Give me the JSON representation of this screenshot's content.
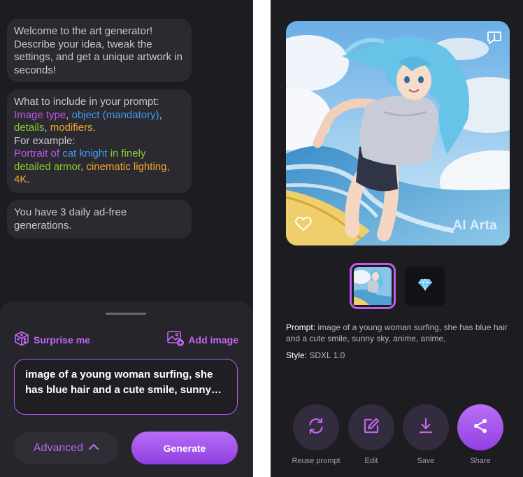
{
  "chat": {
    "welcome": "Welcome to the art generator! Describe your idea, tweak the settings, and get a unique artwork in seconds!",
    "tips": {
      "intro": "What to include in your prompt:",
      "part_image_type": "Image type",
      "sep1": ", ",
      "part_object": "object (mandatory)",
      "sep2": ",",
      "part_details": "details",
      "sep3": ", ",
      "part_modifiers": "modifiers",
      "end": ".",
      "example_label": "For example:",
      "ex_portrait": "Portrait of",
      "ex_cat_knight": "cat knight",
      "ex_finely": "in finely detailed armor",
      "ex_comma": ", ",
      "ex_lighting": "cinematic lighting",
      "ex_comma2": ",",
      "ex_4k": "4K",
      "ex_end": "."
    },
    "daily": "You have 3 daily ad-free generations."
  },
  "sheet": {
    "surprise_label": "Surprise me",
    "add_image_label": "Add image",
    "prompt_value": "image of a young woman surfing, she has blue hair and a cute smile, sunny sky, anime, anime,",
    "advanced_label": "Advanced",
    "generate_label": "Generate"
  },
  "result": {
    "watermark": "AI Arta",
    "prompt_label": "Prompt:",
    "prompt_text": "image of a young woman surfing, she has blue hair and a cute smile, sunny sky, anime, anime,",
    "style_label": "Style:",
    "style_value": "SDXL 1.0",
    "actions": {
      "reuse": "Reuse prompt",
      "edit": "Edit",
      "save": "Save",
      "share": "Share"
    }
  },
  "colors": {
    "accent": "#b45ff0",
    "image_type": "#c054f0",
    "object": "#3f9cf2",
    "details": "#86cc2f",
    "modifiers": "#f2a52d"
  },
  "icons": [
    "dice-icon",
    "add-image-icon",
    "chevron-up-icon",
    "report-icon",
    "heart-icon",
    "diamond-icon",
    "refresh-icon",
    "edit-icon",
    "download-icon",
    "share-icon"
  ]
}
